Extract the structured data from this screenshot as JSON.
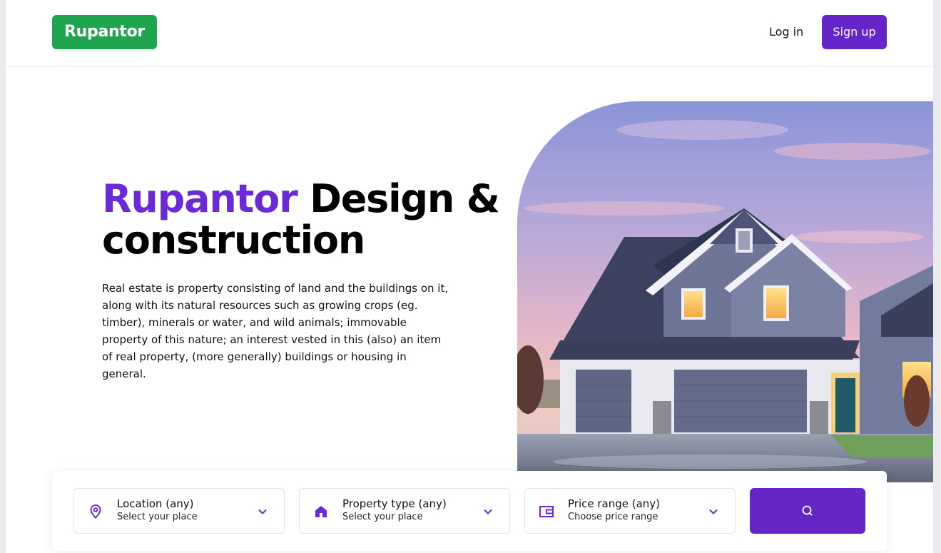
{
  "header": {
    "logo_text": "Rupantor",
    "login_label": "Log in",
    "signup_label": "Sign up"
  },
  "hero": {
    "title_brand": "Rupantor",
    "title_rest_line1": " Design &",
    "title_line2": "construction",
    "description": "Real estate is property consisting of land and the buildings on it, along with its natural resources such as growing crops (eg. timber), minerals or water, and wild animals; immovable property of this nature; an interest vested in this (also) an item of real property, (more generally) buildings or housing in general."
  },
  "search": {
    "location": {
      "title": "Location (any)",
      "subtitle": "Select your place",
      "icon": "map-pin-icon"
    },
    "property_type": {
      "title": "Property type (any)",
      "subtitle": "Select your place",
      "icon": "house-icon"
    },
    "price_range": {
      "title": "Price range (any)",
      "subtitle": "Choose price range",
      "icon": "wallet-icon"
    },
    "button_icon": "search-icon"
  },
  "colors": {
    "brand_green": "#1ea54d",
    "accent_purple": "#6525c9",
    "title_purple": "#6a2ad8"
  }
}
